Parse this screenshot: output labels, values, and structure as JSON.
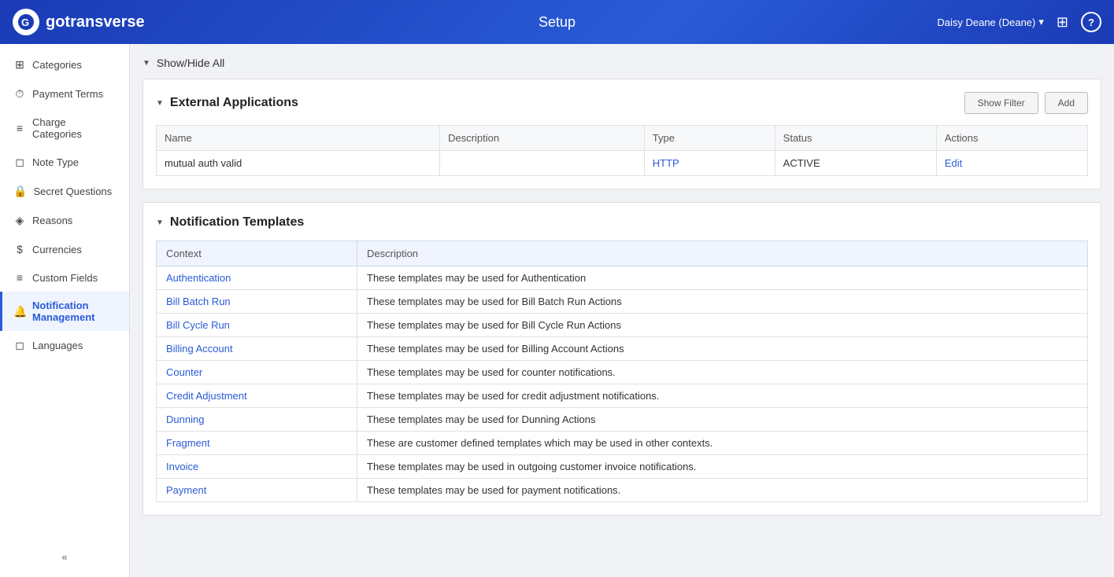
{
  "header": {
    "logo_text": "gotransverse",
    "logo_short": "G",
    "title": "Setup",
    "user": "Daisy Deane (Deane)",
    "dropdown_arrow": "▾",
    "apps_icon": "⊞",
    "help_icon": "?"
  },
  "sidebar": {
    "items": [
      {
        "id": "categories",
        "label": "Categories",
        "icon": "⊞",
        "active": false
      },
      {
        "id": "payment-terms",
        "label": "Payment Terms",
        "icon": "⏱",
        "active": false
      },
      {
        "id": "charge-categories",
        "label": "Charge Categories",
        "icon": "≡",
        "active": false
      },
      {
        "id": "note-type",
        "label": "Note Type",
        "icon": "◻",
        "active": false
      },
      {
        "id": "secret-questions",
        "label": "Secret Questions",
        "icon": "🔒",
        "active": false
      },
      {
        "id": "reasons",
        "label": "Reasons",
        "icon": "$",
        "active": false
      },
      {
        "id": "currencies",
        "label": "Currencies",
        "icon": "$",
        "active": false
      },
      {
        "id": "custom-fields",
        "label": "Custom Fields",
        "icon": "≡",
        "active": false
      },
      {
        "id": "notification-management",
        "label": "Notification Management",
        "icon": "🔔",
        "active": true
      },
      {
        "id": "languages",
        "label": "Languages",
        "icon": "◻",
        "active": false
      }
    ],
    "collapse_label": "«"
  },
  "main": {
    "show_hide_all_label": "Show/Hide All",
    "external_applications": {
      "title": "External Applications",
      "show_filter_btn": "Show Filter",
      "add_btn": "Add",
      "table": {
        "columns": [
          "Name",
          "Description",
          "Type",
          "Status",
          "Actions"
        ],
        "rows": [
          {
            "name": "mutual auth valid",
            "description": "",
            "type": "HTTP",
            "status": "ACTIVE",
            "action": "Edit"
          }
        ]
      }
    },
    "notification_templates": {
      "title": "Notification Templates",
      "table": {
        "columns": [
          "Context",
          "Description"
        ],
        "rows": [
          {
            "context": "Authentication",
            "description": "These templates may be used for Authentication"
          },
          {
            "context": "Bill Batch Run",
            "description": "These templates may be used for Bill Batch Run Actions"
          },
          {
            "context": "Bill Cycle Run",
            "description": "These templates may be used for Bill Cycle Run Actions"
          },
          {
            "context": "Billing Account",
            "description": "These templates may be used for Billing Account Actions"
          },
          {
            "context": "Counter",
            "description": "These templates may be used for counter notifications."
          },
          {
            "context": "Credit Adjustment",
            "description": "These templates may be used for credit adjustment notifications."
          },
          {
            "context": "Dunning",
            "description": "These templates may be used for Dunning Actions"
          },
          {
            "context": "Fragment",
            "description": "These are customer defined templates which may be used in other contexts."
          },
          {
            "context": "Invoice",
            "description": "These templates may be used in outgoing customer invoice notifications."
          },
          {
            "context": "Payment",
            "description": "These templates may be used for payment notifications."
          }
        ]
      }
    }
  }
}
